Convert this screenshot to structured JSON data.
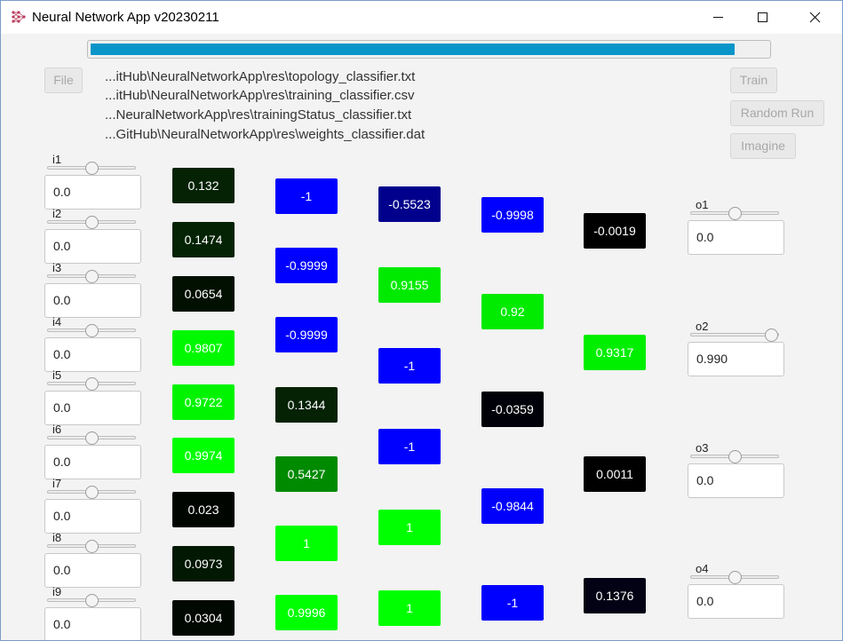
{
  "window": {
    "title": "Neural Network App v20230211",
    "progress_fraction": 0.951
  },
  "toolbar": {
    "file_label": "File",
    "train_label": "Train",
    "random_run_label": "Random Run",
    "imagine_label": "Imagine"
  },
  "paths": [
    "...itHub\\NeuralNetworkApp\\res\\topology_classifier.txt",
    "...itHub\\NeuralNetworkApp\\res\\training_classifier.csv",
    "...NeuralNetworkApp\\res\\trainingStatus_classifier.txt",
    "...GitHub\\NeuralNetworkApp\\res\\weights_classifier.dat"
  ],
  "inputs": [
    {
      "label": "i1",
      "value": "0.0",
      "slider": 0.5
    },
    {
      "label": "i2",
      "value": "0.0",
      "slider": 0.5
    },
    {
      "label": "i3",
      "value": "0.0",
      "slider": 0.5
    },
    {
      "label": "i4",
      "value": "0.0",
      "slider": 0.5
    },
    {
      "label": "i5",
      "value": "0.0",
      "slider": 0.5
    },
    {
      "label": "i6",
      "value": "0.0",
      "slider": 0.5
    },
    {
      "label": "i7",
      "value": "0.0",
      "slider": 0.5
    },
    {
      "label": "i8",
      "value": "0.0",
      "slider": 0.5
    },
    {
      "label": "i9",
      "value": "0.0",
      "slider": 0.5
    }
  ],
  "outputs": [
    {
      "label": "o1",
      "value": "0.0",
      "slider": 0.5
    },
    {
      "label": "o2",
      "value": "0.990",
      "slider": 0.99
    },
    {
      "label": "o3",
      "value": "0.0",
      "slider": 0.5
    },
    {
      "label": "o4",
      "value": "0.0",
      "slider": 0.5
    }
  ],
  "layers": [
    [
      {
        "value": "0.132",
        "color": "#052205"
      },
      {
        "value": "0.1474",
        "color": "#042304"
      },
      {
        "value": "0.0654",
        "color": "#021002"
      },
      {
        "value": "0.9807",
        "color": "#00f800"
      },
      {
        "value": "0.9722",
        "color": "#00f400"
      },
      {
        "value": "0.9974",
        "color": "#00ff00"
      },
      {
        "value": "0.023",
        "color": "#000500"
      },
      {
        "value": "0.0973",
        "color": "#021802"
      },
      {
        "value": "0.0304",
        "color": "#010701"
      }
    ],
    [
      {
        "value": "-1",
        "color": "#0000ff"
      },
      {
        "value": "-0.9999",
        "color": "#0000ff"
      },
      {
        "value": "-0.9999",
        "color": "#0000ff"
      },
      {
        "value": "0.1344",
        "color": "#052205"
      },
      {
        "value": "0.5427",
        "color": "#008a00"
      },
      {
        "value": "1",
        "color": "#00ff00"
      },
      {
        "value": "0.9996",
        "color": "#00ff00"
      }
    ],
    [
      {
        "value": "-0.5523",
        "color": "#00008c"
      },
      {
        "value": "0.9155",
        "color": "#00ea00"
      },
      {
        "value": "-1",
        "color": "#0000ff"
      },
      {
        "value": "-1",
        "color": "#0000ff"
      },
      {
        "value": "1",
        "color": "#00ff00"
      },
      {
        "value": "1",
        "color": "#00ff00"
      }
    ],
    [
      {
        "value": "-0.9998",
        "color": "#0000ff"
      },
      {
        "value": "0.92",
        "color": "#00eb00"
      },
      {
        "value": "-0.0359",
        "color": "#000009"
      },
      {
        "value": "-0.9844",
        "color": "#0000fb"
      },
      {
        "value": "-1",
        "color": "#0000ff"
      }
    ],
    [
      {
        "value": "-0.0019",
        "color": "#000000"
      },
      {
        "value": "0.9317",
        "color": "#00ee00"
      },
      {
        "value": "0.0011",
        "color": "#000000"
      },
      {
        "value": "0.1376",
        "color": "#020214"
      }
    ]
  ]
}
